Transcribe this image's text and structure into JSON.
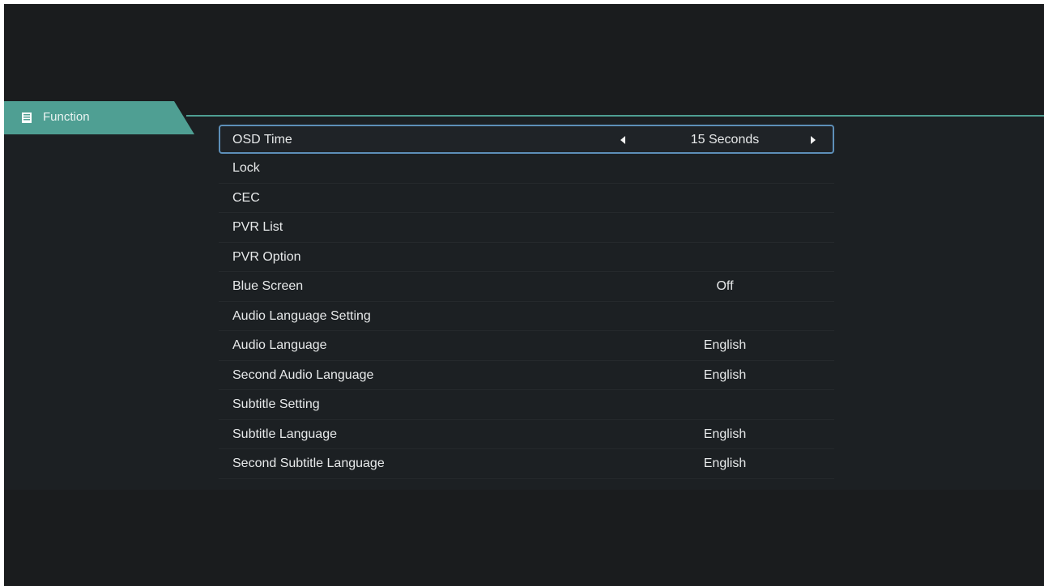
{
  "tab": {
    "label": "Function",
    "icon": "document-list-icon"
  },
  "menu": {
    "items": [
      {
        "label": "OSD Time",
        "value": "15 Seconds",
        "selected": true
      },
      {
        "label": "Lock",
        "value": ""
      },
      {
        "label": "CEC",
        "value": ""
      },
      {
        "label": "PVR List",
        "value": ""
      },
      {
        "label": "PVR Option",
        "value": ""
      },
      {
        "label": "Blue Screen",
        "value": "Off"
      },
      {
        "label": "Audio Language Setting",
        "value": ""
      },
      {
        "label": "Audio Language",
        "value": "English"
      },
      {
        "label": "Second Audio Language",
        "value": "English"
      },
      {
        "label": "Subtitle Setting",
        "value": ""
      },
      {
        "label": "Subtitle Language",
        "value": "English"
      },
      {
        "label": "Second Subtitle Language",
        "value": "English"
      }
    ]
  },
  "colors": {
    "accent": "#4f9f93",
    "selection_border": "#5d8fb8",
    "background": "#1a1c1e"
  }
}
